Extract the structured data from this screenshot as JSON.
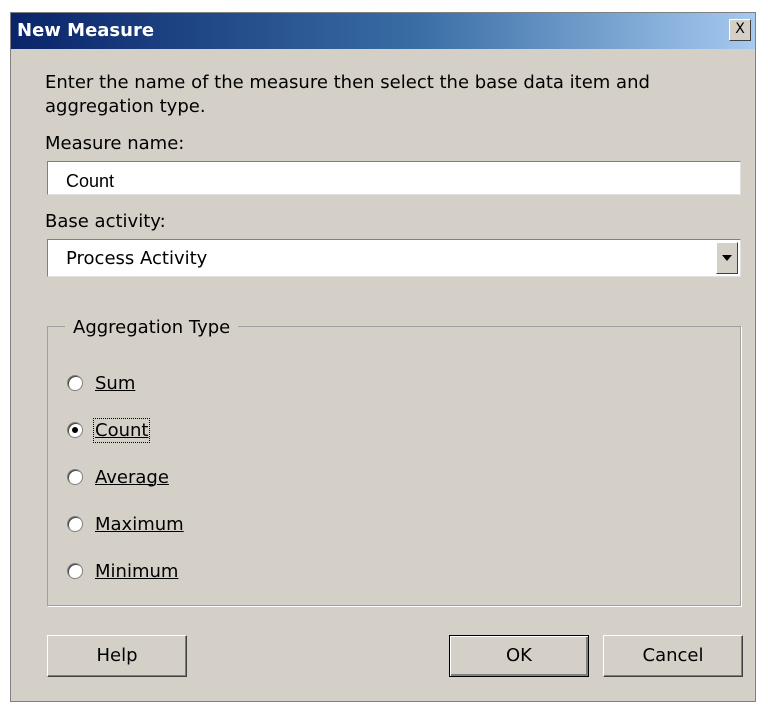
{
  "dialog": {
    "title": "New Measure",
    "close_label": "X",
    "intro": "Enter the name of the measure then select the base data item and aggregation type."
  },
  "measure_name": {
    "label": "Measure name:",
    "value": "Count"
  },
  "base_activity": {
    "label": "Base activity:",
    "selected": "Process Activity"
  },
  "aggregation": {
    "legend": "Aggregation Type",
    "options": [
      {
        "label": "Sum",
        "checked": false
      },
      {
        "label": "Count",
        "checked": true
      },
      {
        "label": "Average",
        "checked": false
      },
      {
        "label": "Maximum",
        "checked": false
      },
      {
        "label": "Minimum",
        "checked": false
      }
    ]
  },
  "buttons": {
    "help": "Help",
    "ok": "OK",
    "cancel": "Cancel"
  },
  "colors": {
    "dialog_bg": "#d4d0c8",
    "title_start": "#0a246a",
    "title_end": "#a6caf0"
  }
}
